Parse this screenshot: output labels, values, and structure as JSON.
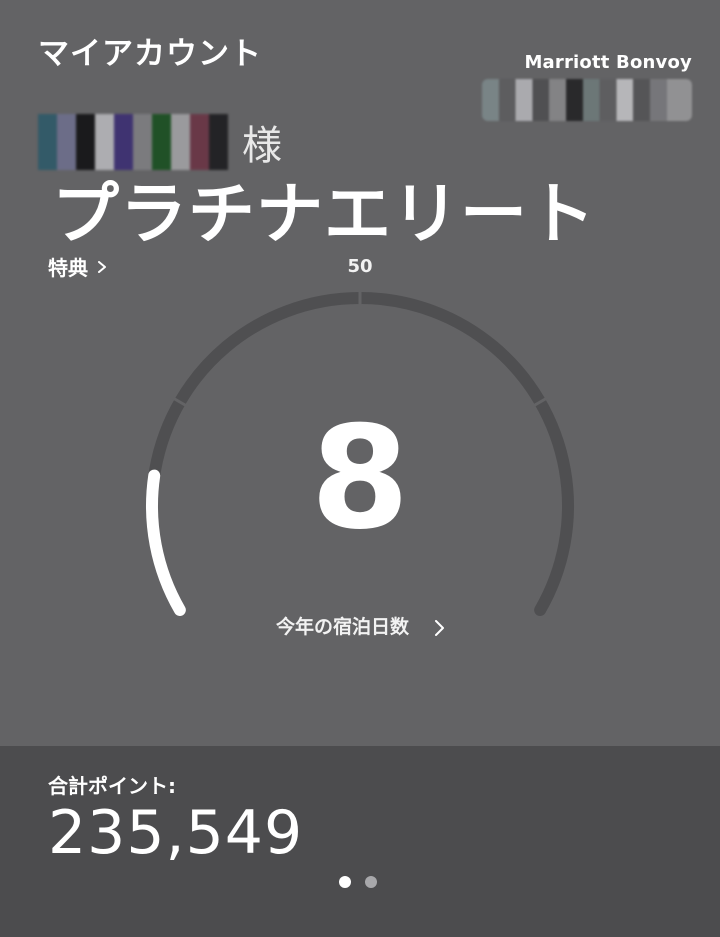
{
  "header": {
    "title": "マイアカウント"
  },
  "brand": {
    "name": "Marriott Bonvoy"
  },
  "member": {
    "honorific": "様",
    "status_level": "プラチナエリート",
    "benefits_label": "特典"
  },
  "gauge": {
    "max_label": "50",
    "value": "8",
    "nights_label": "今年の宿泊日数",
    "progress_fraction": 0.16
  },
  "points": {
    "label": "合計ポイント:",
    "value": "235,549"
  },
  "pager": {
    "active_index": 0,
    "count": 2
  },
  "colors": {
    "background": "#636365",
    "points_panel": "#4c4c4e",
    "track": "#4f4f51",
    "progress": "#ffffff"
  }
}
